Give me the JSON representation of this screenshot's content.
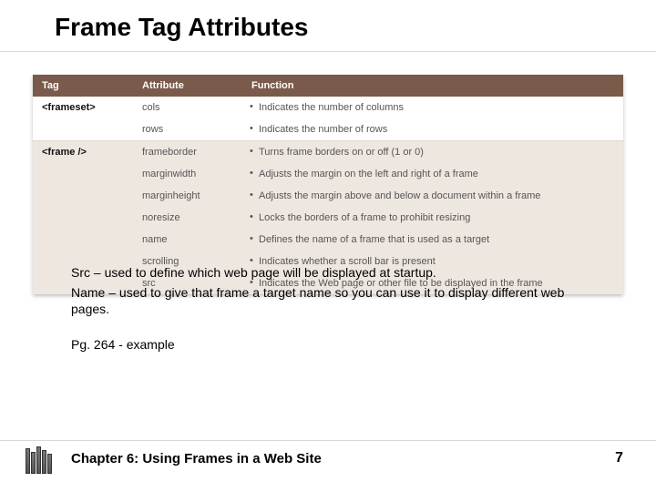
{
  "title": "Frame Tag Attributes",
  "table": {
    "headers": [
      "Tag",
      "Attribute",
      "Function"
    ],
    "groups": [
      {
        "tag": "<frameset>",
        "band": "light",
        "rows": [
          {
            "attribute": "cols",
            "function": "Indicates the number of columns"
          },
          {
            "attribute": "rows",
            "function": "Indicates the number of rows"
          }
        ]
      },
      {
        "tag": "<frame />",
        "band": "beige",
        "rows": [
          {
            "attribute": "frameborder",
            "function": "Turns frame borders on or off (1 or 0)"
          },
          {
            "attribute": "marginwidth",
            "function": "Adjusts the margin on the left and right of a frame"
          },
          {
            "attribute": "marginheight",
            "function": "Adjusts the margin above and below a document within a frame"
          },
          {
            "attribute": "noresize",
            "function": "Locks the borders of a frame to prohibit resizing"
          },
          {
            "attribute": "name",
            "function": "Defines the name of a frame that is used as a target"
          },
          {
            "attribute": "scrolling",
            "function": "Indicates whether a scroll bar is present"
          },
          {
            "attribute": "src",
            "function": "Indicates the Web page or other file to be displayed in the frame"
          }
        ]
      }
    ]
  },
  "notes": {
    "line1": "Src – used to define which web page will be displayed at startup.",
    "line2": "Name – used to give that frame a target name so you can use it to display different web pages."
  },
  "page_ref": "Pg. 264 - example",
  "chapter": "Chapter 6: Using Frames in a Web Site",
  "page_number": "7",
  "colors": {
    "header_bg": "#7a5a4a",
    "band_beige": "#eee7e0"
  }
}
